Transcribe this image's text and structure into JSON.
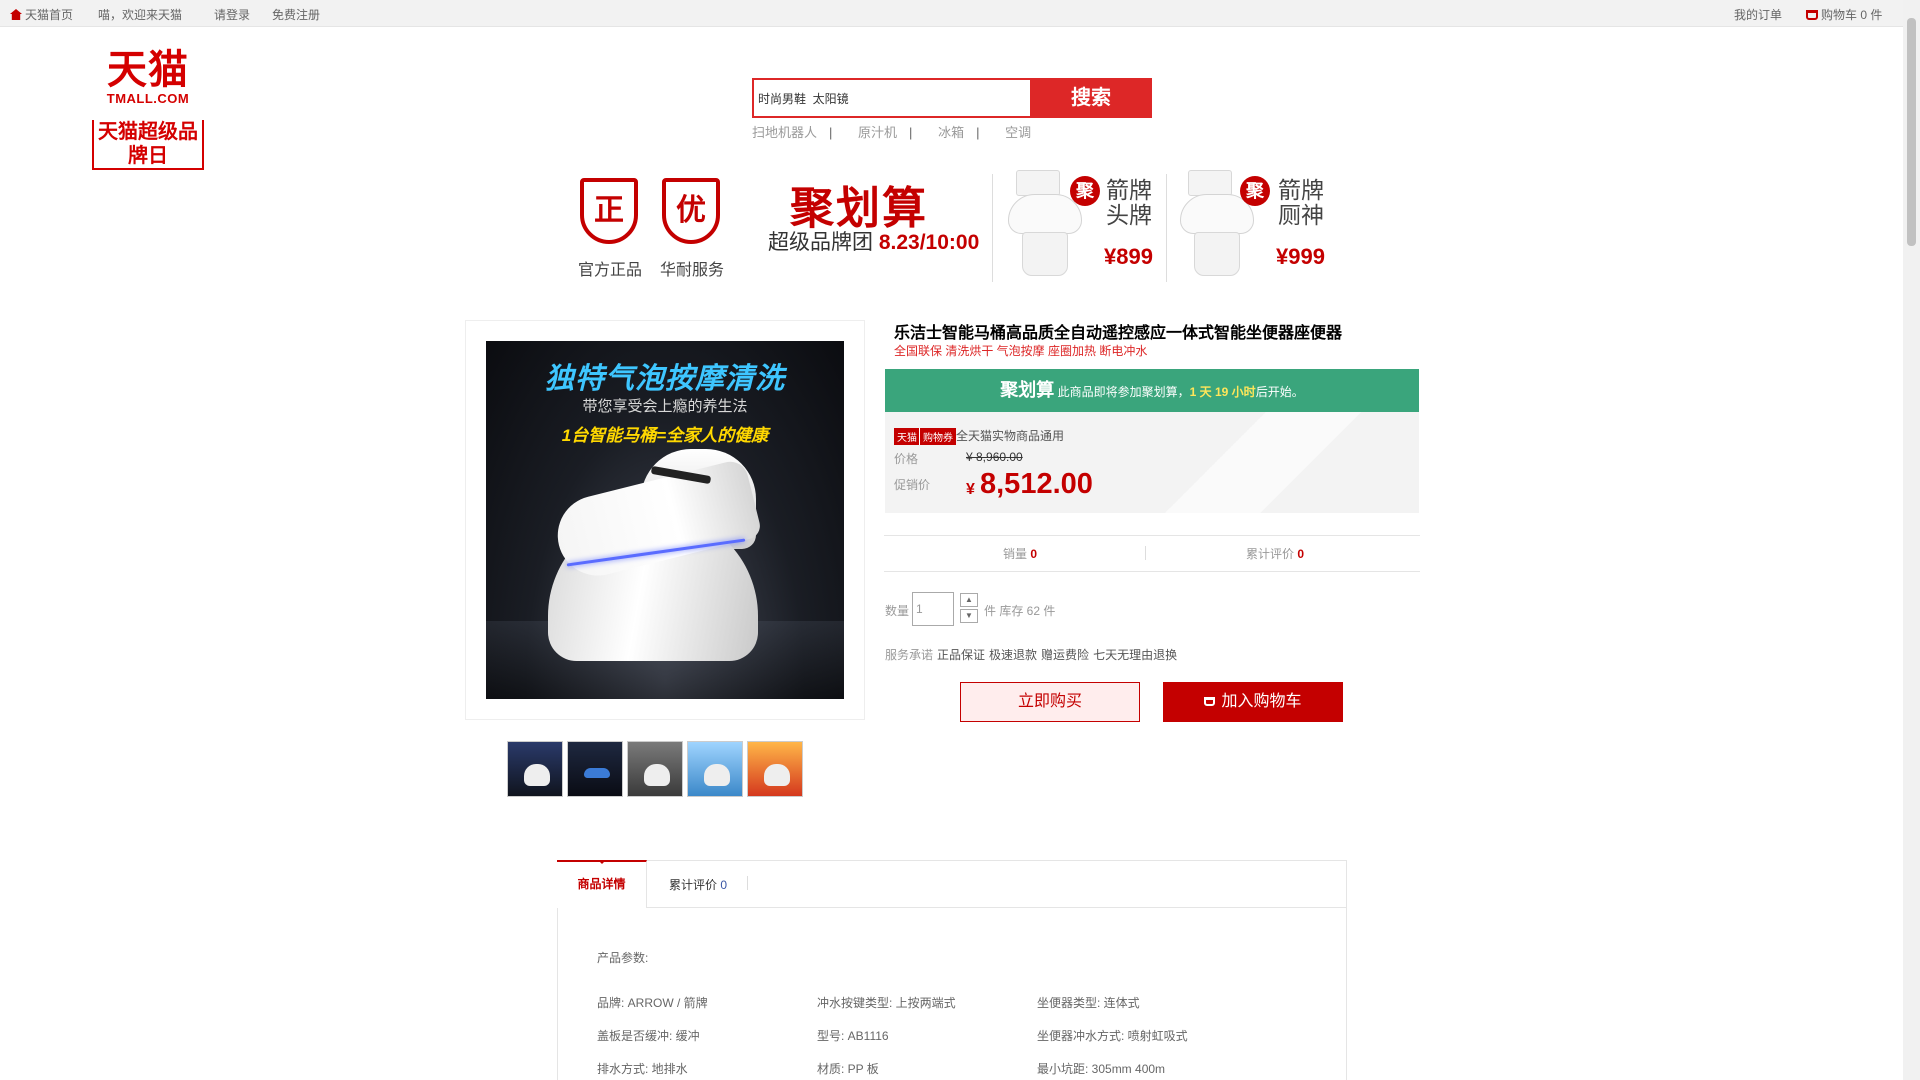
{
  "topbar": {
    "home": "天猫首页",
    "welcome": "喵，欢迎来天猫",
    "login": "请登录",
    "register": "免费注册",
    "orders": "我的订单",
    "cart": "购物车 0 件"
  },
  "logo": {
    "line1": "天猫",
    "line2": "TMALL.COM",
    "line3": "天猫超级品牌日"
  },
  "search": {
    "value": "时尚男鞋  太阳镜",
    "button": "搜索",
    "hot_words": [
      "扫地机器人",
      "原汁机",
      "冰箱",
      "空调"
    ],
    "separator": "|"
  },
  "banner": {
    "badge1": "正",
    "badge1_label": "官方正品",
    "badge2": "优",
    "badge2_label": "华耐服务",
    "jhs_title": "聚划算",
    "jhs_sub_prefix": "超级品牌团",
    "jhs_sub_time": "8.23/10:00",
    "ads": [
      {
        "mark": "聚",
        "line1": "箭牌",
        "line2": "头牌",
        "price": "¥899"
      },
      {
        "mark": "聚",
        "line1": "箭牌",
        "line2": "厕神",
        "price": "¥999"
      }
    ]
  },
  "gallery": {
    "heading": "独特气泡按摩清洗",
    "subheading": "带您享受会上瘾的养生法",
    "tagline": "1台智能马桶=全家人的健康",
    "thumbnail_count_label": ""
  },
  "product": {
    "title": "乐洁士智能马桶高品质全自动遥控感应一体式智能坐便器座便器",
    "subtitle": "全国联保 清洗烘干 气泡按摩 座圈加热 断电冲水",
    "jhs_label": "聚划算",
    "jhs_notice_pre": "此商品即将参加聚划算，",
    "jhs_time": "1 天 19 小时",
    "jhs_notice_post": "后开始。",
    "tag_tmall": "天猫",
    "tag_coupon": "购物券",
    "coupon_text": "全天猫实物商品通用",
    "price_label": "价格",
    "orig_price": "¥ 8,960.00",
    "sale_label": "促销价",
    "sale_currency": "¥",
    "sale_price": "8,512.00",
    "sales_label": "销量",
    "sales_value": "0",
    "reviews_label": "累计评价",
    "reviews_value": "0",
    "qty_label": "数量",
    "qty_value": "1",
    "stock_text": "件 库存 62 件",
    "service_label": "服务承诺",
    "services": [
      "正品保证",
      "极速退款",
      "赠运费险",
      "七天无理由退换"
    ],
    "buy_now": "立即购买",
    "add_cart": "加入购物车"
  },
  "tabs": {
    "details": "商品详情",
    "reviews": "累计评价",
    "reviews_count": "0"
  },
  "params": {
    "title": "产品参数:",
    "rows": [
      [
        "品牌: ARROW / 箭牌",
        "冲水按键类型: 上按两端式",
        "坐便器类型: 连体式"
      ],
      [
        "盖板是否缓冲: 缓冲",
        "型号: AB1116",
        "坐便器冲水方式: 喷射虹吸式"
      ],
      [
        "排水方式: 地排水",
        "材质: PP 板",
        "最小坑距: 305mm 400m"
      ]
    ]
  },
  "colors": {
    "brand_red": "#c40000",
    "jhs_green": "#3aa57c",
    "link_blue": "#3a56a5"
  }
}
